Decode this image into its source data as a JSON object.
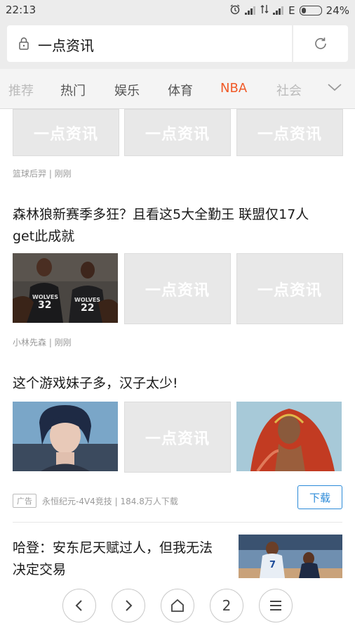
{
  "status": {
    "time": "22:13",
    "battery": "24%",
    "network_letter": "E"
  },
  "address": {
    "title": "一点资讯"
  },
  "tabs": [
    {
      "label": "推荐"
    },
    {
      "label": "热门"
    },
    {
      "label": "娱乐"
    },
    {
      "label": "体育"
    },
    {
      "label": "NBA"
    },
    {
      "label": "社会"
    }
  ],
  "placeholder_text": "一点资讯",
  "articles": [
    {
      "meta": "篮球后羿 | 刚刚"
    },
    {
      "title_line1": "森林狼新赛季多狂？且看这5大全勤王 联盟仅17人",
      "title_line2": "get此成就",
      "jersey_left": "32",
      "jersey_right": "22",
      "team": "WOLVES",
      "meta": "小林先森 | 刚刚"
    },
    {
      "title": "这个游戏妹子多，汉子太少!",
      "ad_tag": "广告",
      "meta": "永恒纪元-4V4竞技 | 184.8万人下载",
      "download": "下载"
    },
    {
      "title_line1": "哈登：安东尼天赋过人，但我无法",
      "title_line2": "决定交易",
      "jersey": "7"
    }
  ],
  "bottom_nav": {
    "tabs_count": "2"
  }
}
